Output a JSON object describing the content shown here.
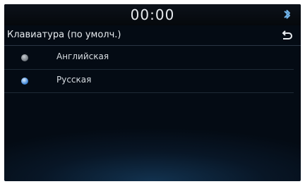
{
  "status": {
    "time": "00:00"
  },
  "header": {
    "title": "Клавиатура (по умолч.)"
  },
  "options": [
    {
      "label": "Английская",
      "selected": false
    },
    {
      "label": "Русская",
      "selected": true
    }
  ],
  "icons": {
    "status": "bluetooth-icon",
    "back": "back-icon"
  },
  "colors": {
    "accent": "#3f86d8",
    "background": "#040b14"
  }
}
